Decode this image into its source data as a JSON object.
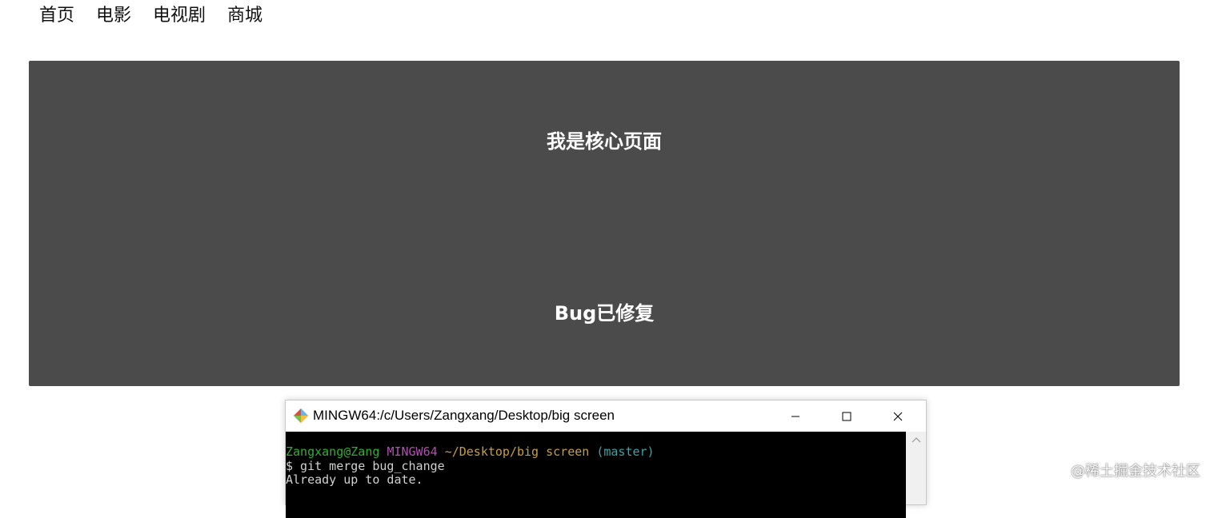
{
  "nav": {
    "items": [
      {
        "label": "首页"
      },
      {
        "label": "电影"
      },
      {
        "label": "电视剧"
      },
      {
        "label": "商城"
      }
    ]
  },
  "core": {
    "title": "我是核心页面",
    "status": "Bug已修复",
    "background": "#4b4b4b"
  },
  "terminal": {
    "title": "MINGW64:/c/Users/Zangxang/Desktop/big screen",
    "prompt_user": "Zangxang@Zang",
    "prompt_system": "MINGW64",
    "prompt_path": "~/Desktop/big screen",
    "prompt_branch": "(master)",
    "command": "$ git merge bug_change",
    "output": "Already up to date.",
    "colors": {
      "user": "#2fb12f",
      "system": "#b34fb3",
      "path": "#c8a03c",
      "branch": "#3aa5a5"
    }
  },
  "watermark": {
    "text": "@稀土掘金技术社区"
  }
}
